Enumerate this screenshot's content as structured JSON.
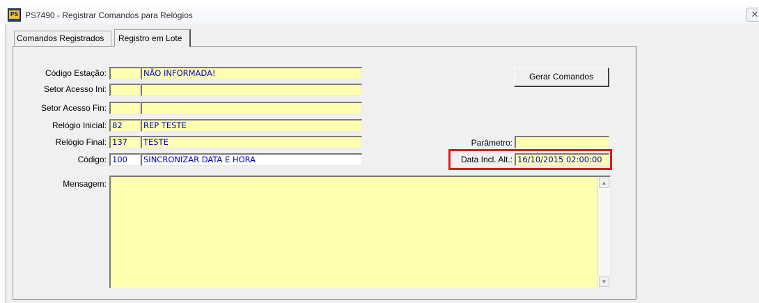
{
  "window": {
    "title": "PS7490 - Registrar Comandos para Relógios",
    "icon": "app-icon",
    "icon_text": "PS",
    "close_glyph": "✕"
  },
  "tabs": [
    {
      "label": "Comandos Registrados",
      "active": false
    },
    {
      "label": "Registro em Lote",
      "active": true
    }
  ],
  "form": {
    "codigo_estacao": {
      "label": "Código Estação:",
      "code": "",
      "desc": "NÃO INFORMADA!"
    },
    "setor_ini": {
      "label": "Setor Acesso Ini:",
      "code": "",
      "desc": ""
    },
    "setor_fin": {
      "label": "Setor Acesso Fin:",
      "code": "",
      "desc": ""
    },
    "relogio_inicial": {
      "label": "Relógio Inicial:",
      "code": "82",
      "desc": "REP TESTE"
    },
    "relogio_final": {
      "label": "Relógio Final:",
      "code": "137",
      "desc": "TESTE"
    },
    "codigo": {
      "label": "Código:",
      "code": "100",
      "desc": "SINCRONIZAR DATA E HORA"
    },
    "parametro": {
      "label": "Parâmetro:",
      "value": ""
    },
    "data_incl": {
      "label": "Data Incl. Alt.:",
      "value": "16/10/2015 02:00:00"
    },
    "mensagem": {
      "label": "Mensagem:",
      "value": ""
    },
    "gerar_button": "Gerar Comandos"
  },
  "colors": {
    "field_bg": "#ffffb2",
    "field_text": "#0000cc",
    "highlight": "#e0191b"
  }
}
